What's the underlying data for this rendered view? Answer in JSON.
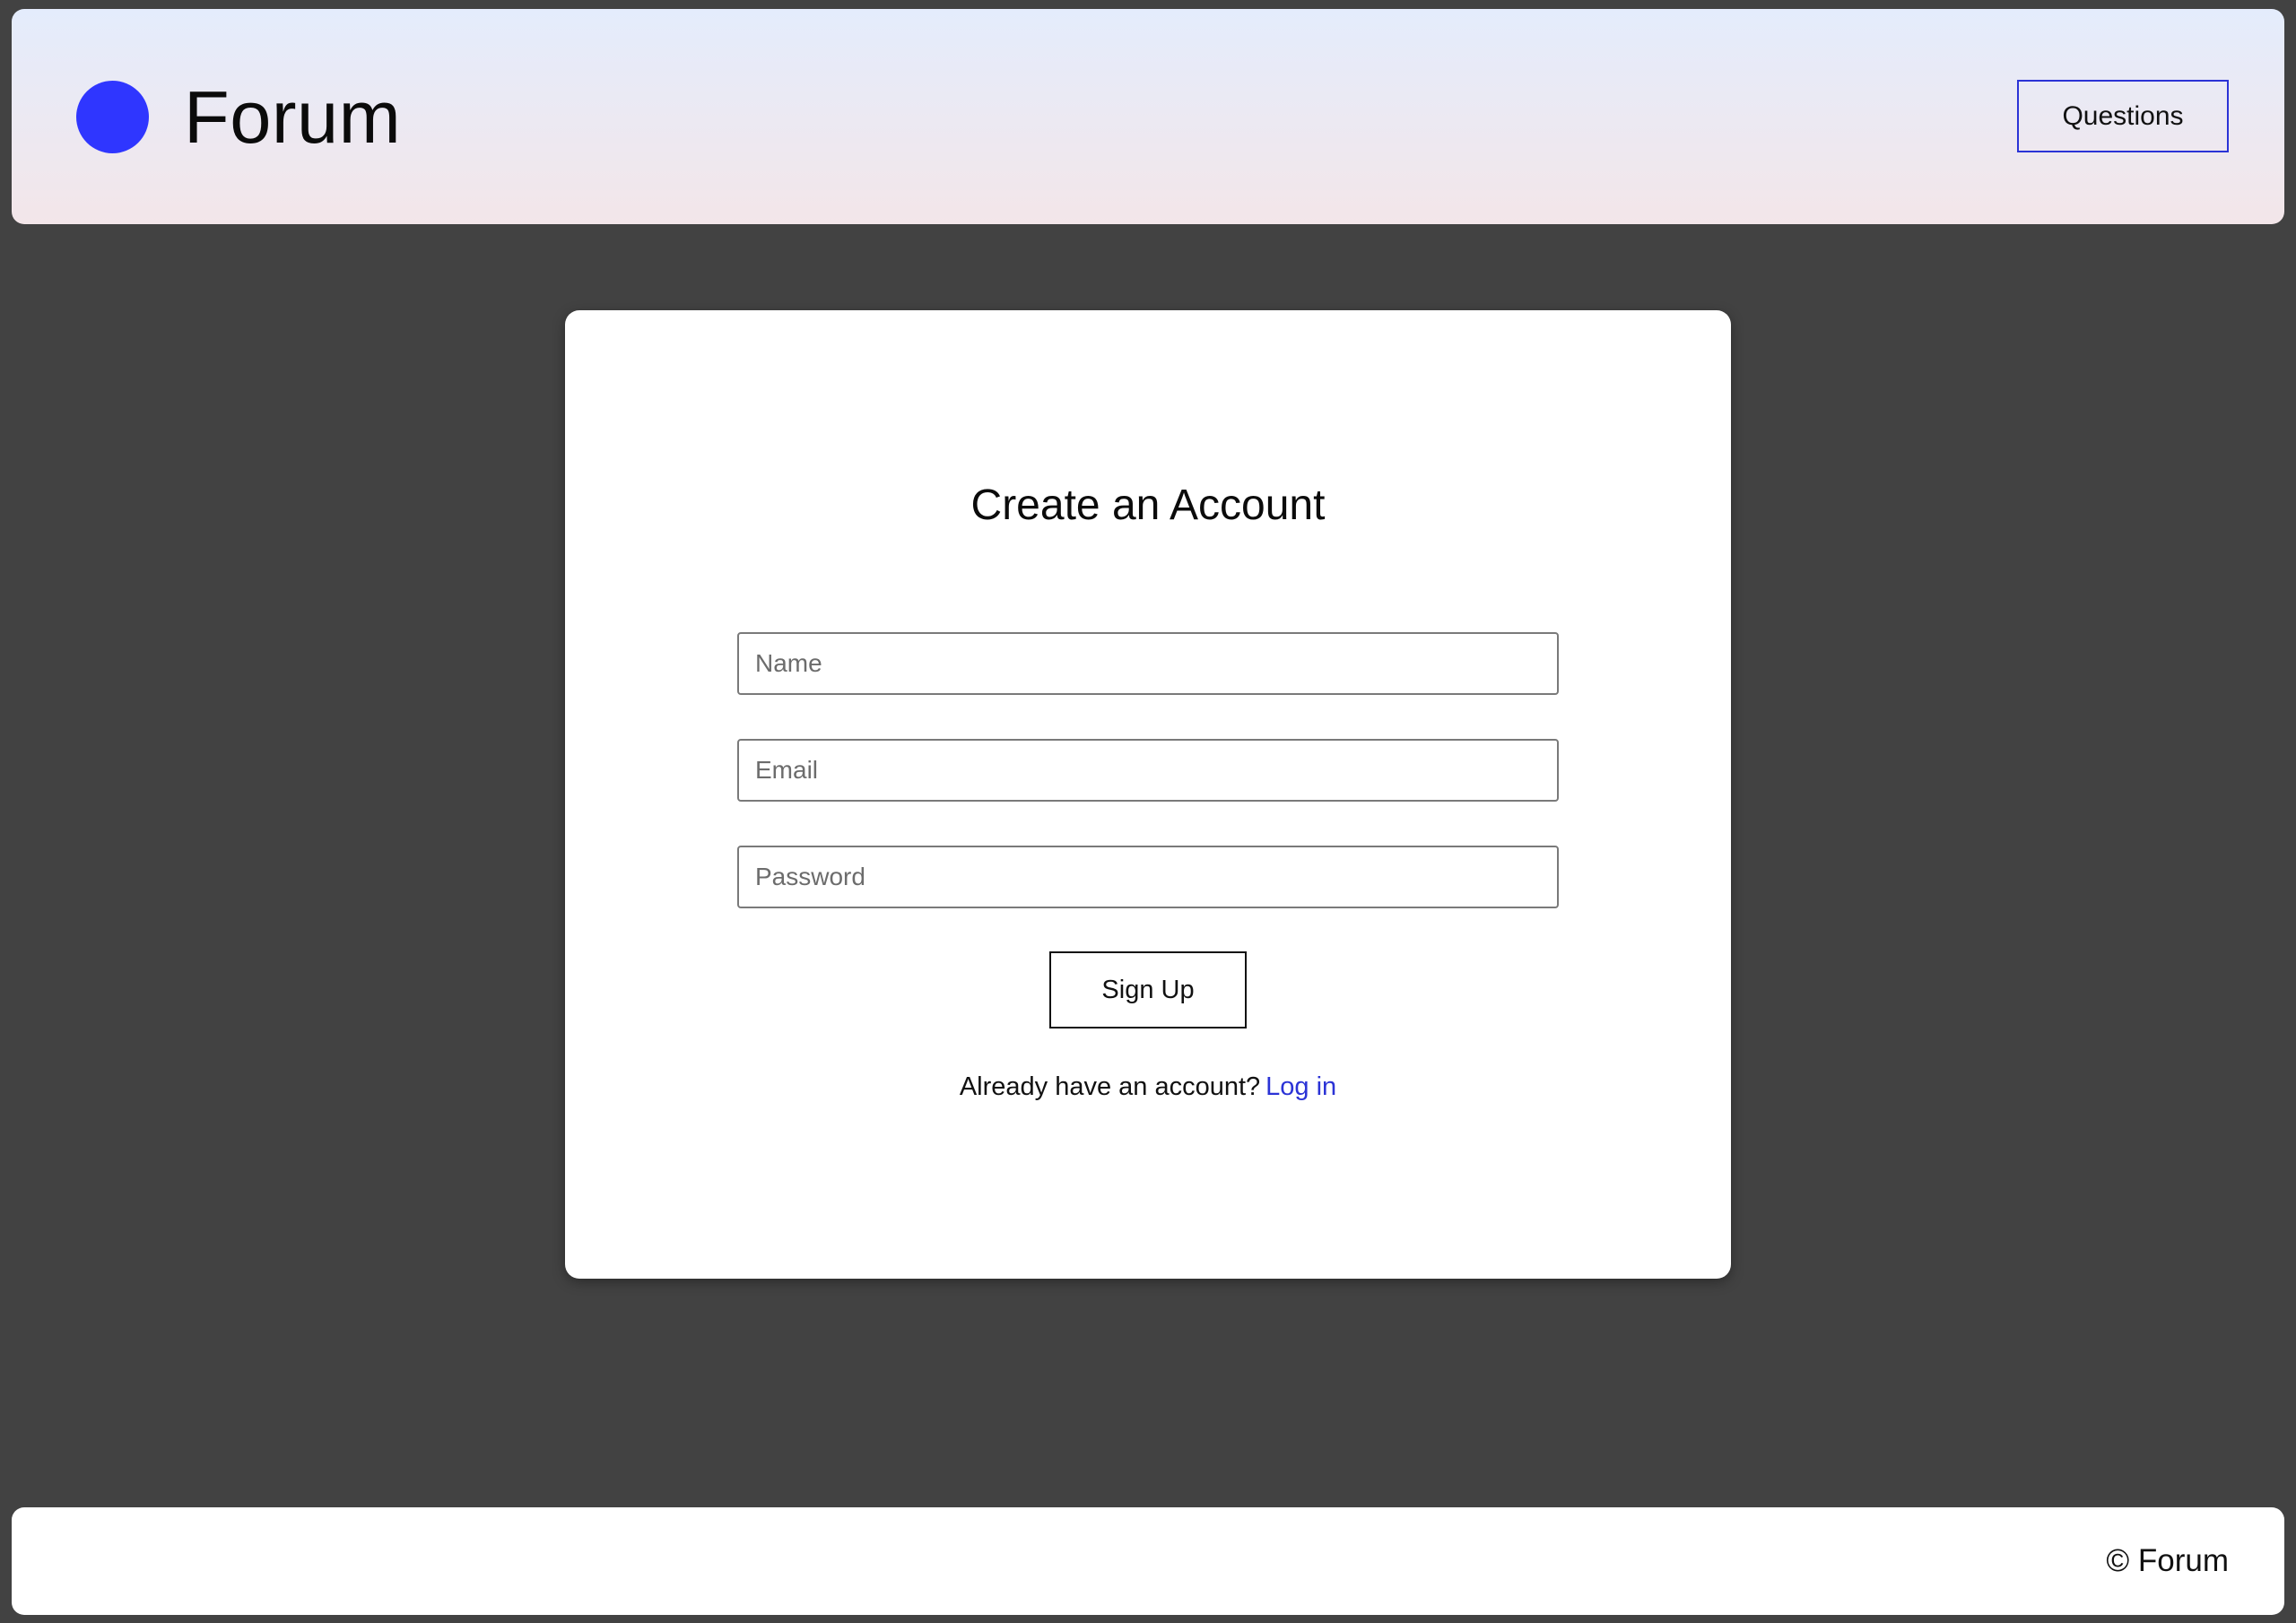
{
  "header": {
    "brand": "Forum",
    "nav_button": "Questions",
    "logo_color": "#2f36ff"
  },
  "signup": {
    "title": "Create an Account",
    "name_placeholder": "Name",
    "email_placeholder": "Email",
    "password_placeholder": "Password",
    "submit_label": "Sign Up",
    "login_prompt": "Already have an account?",
    "login_link": "Log in"
  },
  "footer": {
    "copyright": "© Forum"
  },
  "colors": {
    "accent": "#2b33d6",
    "background": "#424242"
  }
}
